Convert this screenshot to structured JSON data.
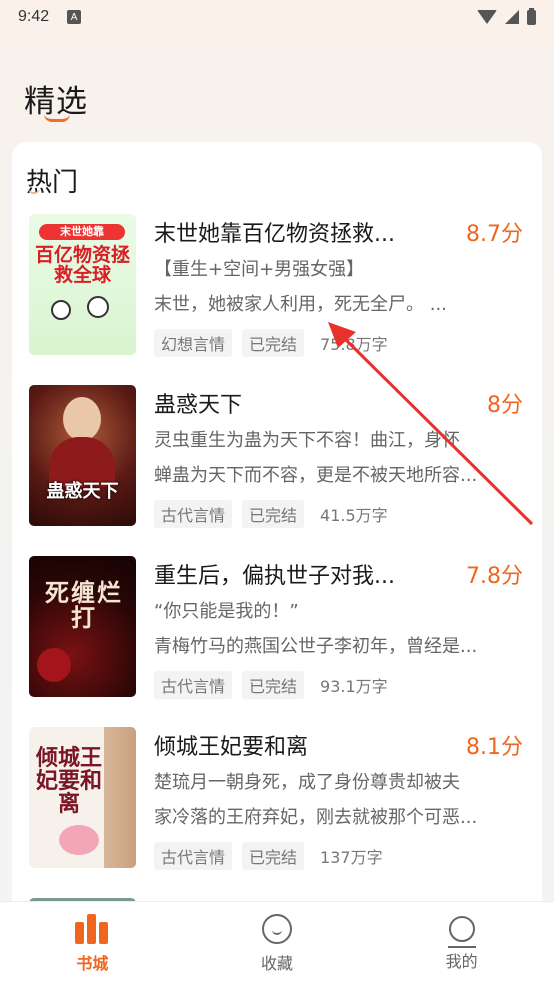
{
  "status_bar": {
    "time": "9:42",
    "notification_badge": "A"
  },
  "page": {
    "title": "精选"
  },
  "section": {
    "title": "热门"
  },
  "books": [
    {
      "title": "末世她靠百亿物资拯救...",
      "score": "8.7分",
      "desc_line1": "【重生+空间+男强女强】",
      "desc_line2": "末世，她被家人利用，死无全尸。 ...",
      "tags": [
        "幻想言情",
        "已完结"
      ],
      "word_count": "75.8万字",
      "cover_text": "百亿物资拯救全球",
      "cover_badge": "末世她靠"
    },
    {
      "title": "蛊惑天下",
      "score": "8分",
      "desc_line1": "灵虫重生为蛊为天下不容！曲江，身怀",
      "desc_line2": "蝉蛊为天下而不容，更是不被天地所容...",
      "tags": [
        "古代言情",
        "已完结"
      ],
      "word_count": "41.5万字",
      "cover_text": "蛊惑天下"
    },
    {
      "title": "重生后，偏执世子对我...",
      "score": "7.8分",
      "desc_line1": "“你只能是我的！”",
      "desc_line2": "青梅竹马的燕国公世子李初年，曾经是...",
      "tags": [
        "古代言情",
        "已完结"
      ],
      "word_count": "93.1万字",
      "cover_text": "死缠烂打"
    },
    {
      "title": "倾城王妃要和离",
      "score": "8.1分",
      "desc_line1": "楚琉月一朝身死，成了身份尊贵却被夫",
      "desc_line2": "家冷落的王府弃妃，刚去就被那个可恶...",
      "tags": [
        "古代言情",
        "已完结"
      ],
      "word_count": "137万字",
      "cover_text": "倾城王妃要和离"
    }
  ],
  "tabs": [
    {
      "label": "书城",
      "icon": "bookshelf-icon",
      "active": true
    },
    {
      "label": "收藏",
      "icon": "heart-icon",
      "active": false
    },
    {
      "label": "我的",
      "icon": "user-icon",
      "active": false
    }
  ],
  "colors": {
    "accent": "#f0661f",
    "annotation_arrow": "#e8312b"
  }
}
